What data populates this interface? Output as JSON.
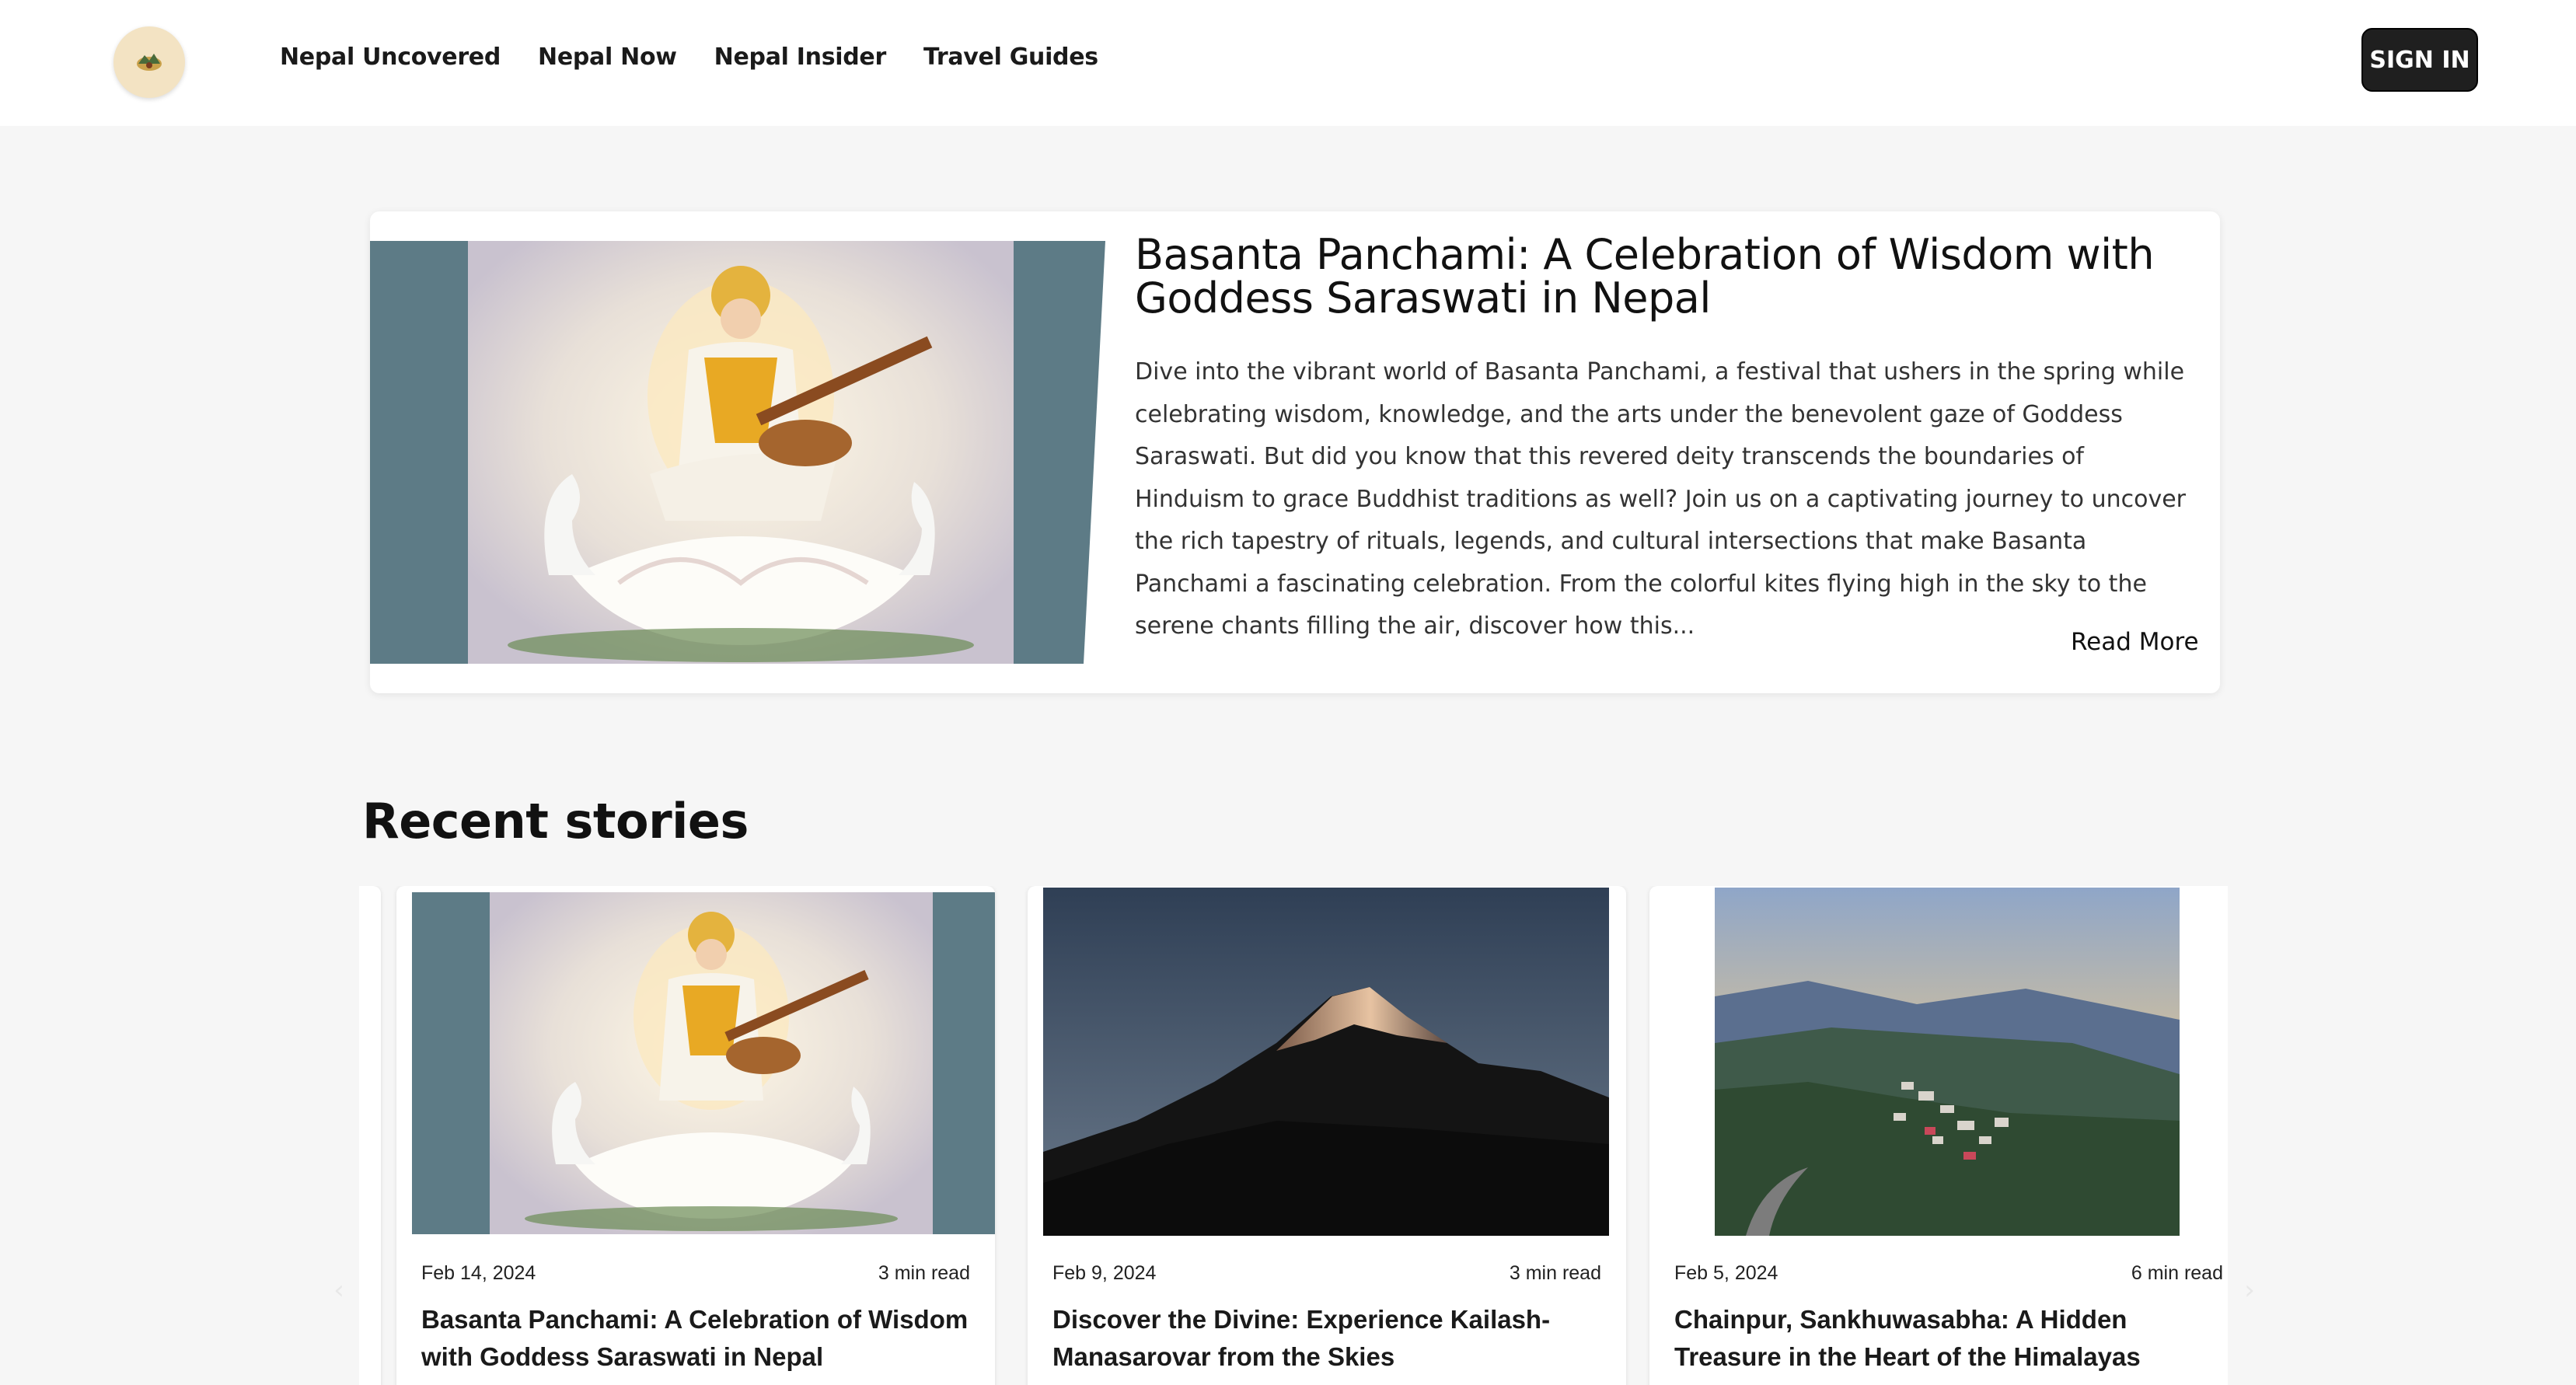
{
  "header": {
    "logo_icon": "nepal-logo-icon",
    "nav": [
      "Nepal Uncovered",
      "Nepal Now",
      "Nepal Insider",
      "Travel Guides"
    ],
    "sign_in": "SIGN IN"
  },
  "featured": {
    "title": "Basanta Panchami: A Celebration of Wisdom with Goddess Saraswati in Nepal",
    "description": "Dive into the vibrant world of Basanta Panchami, a festival that ushers in the spring while celebrating wisdom, knowledge, and the arts under the benevolent gaze of Goddess Saraswati. But did you know that this revered deity transcends the boundaries of Hinduism to grace Buddhist traditions as well? Join us on a captivating journey to uncover the rich tapestry of rituals, legends, and cultural intersections that make Basanta Panchami a fascinating celebration. From the colorful kites flying high in the sky to the serene chants filling the air, discover how this...",
    "read_more": "Read More"
  },
  "recent": {
    "title": "Recent stories",
    "cards": [
      {
        "date": "Feb 14, 2024",
        "read_time": "3 min read",
        "title": "Basanta Panchami: A Celebration of Wisdom with Goddess Saraswati in Nepal"
      },
      {
        "date": "Feb 9, 2024",
        "read_time": "3 min read",
        "title": "Discover the Divine: Experience Kailash-Manasarovar from the Skies"
      },
      {
        "date": "Feb 5, 2024",
        "read_time": "6 min read",
        "title": "Chainpur, Sankhuwasabha: A Hidden Treasure in the Heart of the Himalayas"
      }
    ]
  },
  "icons": {
    "prev": "chevron-left-icon",
    "next": "chevron-right-icon"
  },
  "colors": {
    "signin_bg": "#1f1f1f",
    "page_bg": "#f6f6f6"
  }
}
